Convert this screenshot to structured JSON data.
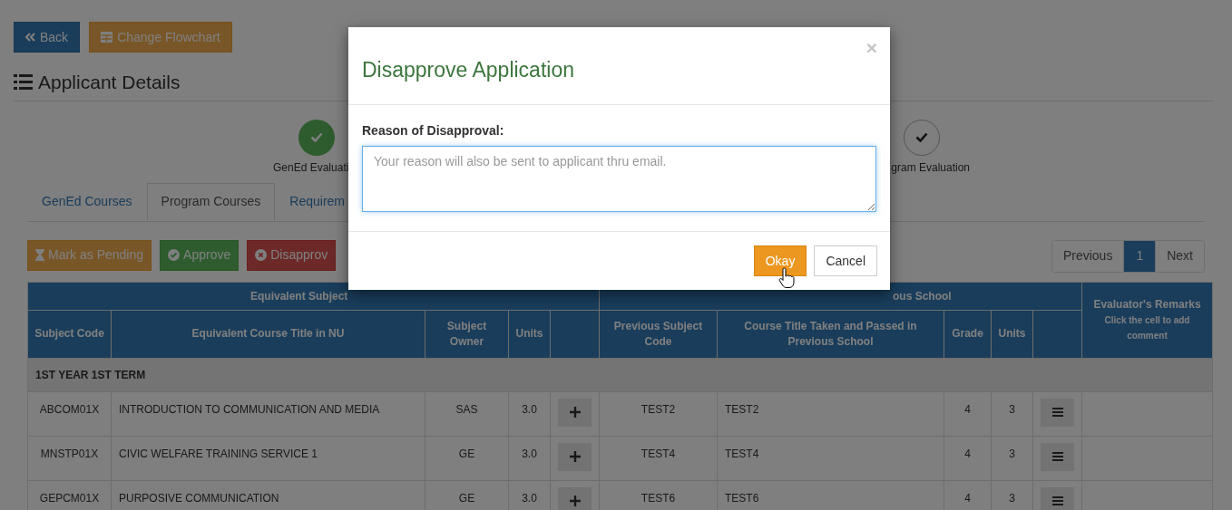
{
  "toolbar": [
    {
      "label": "Back",
      "kind": "back"
    },
    {
      "label": "Change Flowchart",
      "kind": "flowchart"
    }
  ],
  "heading": "Applicant Details",
  "stepper": [
    {
      "label": "GenEd Evaluati",
      "kind": "filled"
    },
    {
      "label": "gram Evaluation",
      "kind": "outline"
    }
  ],
  "tabs": [
    {
      "label": "GenEd Courses",
      "selected": false
    },
    {
      "label": "Program Courses",
      "selected": true
    },
    {
      "label": "Requirem",
      "selected": false
    }
  ],
  "actions": [
    {
      "label": "Mark as Pending",
      "kind": "pending"
    },
    {
      "label": "Approve",
      "kind": "approve"
    },
    {
      "label": "Disapprov",
      "kind": "disapprove"
    }
  ],
  "pagination": [
    {
      "label": "Previous",
      "selected": false
    },
    {
      "label": "1",
      "selected": true
    },
    {
      "label": "Next",
      "selected": false
    }
  ],
  "table": {
    "groups": [
      "Equivalent Subject",
      "ous School"
    ],
    "columns": [
      "Subject Code",
      "Equivalent Course Title in NU",
      "Subject Owner",
      "Units",
      "Previous Subject Code",
      "Course Title Taken and Passed in Previous School",
      "Grade",
      "Units"
    ],
    "remarks": {
      "title": "Evaluator's Remarks",
      "hint": "Click the cell to add comment"
    },
    "sections": [
      {
        "title": "1ST YEAR 1ST TERM",
        "rows": [
          {
            "code": "ABCOM01X",
            "title": "INTRODUCTION TO COMMUNICATION AND MEDIA",
            "owner": "SAS",
            "units": "3.0",
            "prev_code": "TEST2",
            "prev_title": "TEST2",
            "grade": "4",
            "prev_units": "3"
          },
          {
            "code": "MNSTP01X",
            "title": "CIVIC WELFARE TRAINING SERVICE 1",
            "owner": "GE",
            "units": "3.0",
            "prev_code": "TEST4",
            "prev_title": "TEST4",
            "grade": "4",
            "prev_units": "3"
          },
          {
            "code": "GEPCM01X",
            "title": "PURPOSIVE COMMUNICATION",
            "owner": "GE",
            "units": "3.0",
            "prev_code": "TEST6",
            "prev_title": "TEST6",
            "grade": "4",
            "prev_units": "3"
          }
        ]
      }
    ]
  },
  "modal": {
    "title": "Disapprove Application",
    "close": "×",
    "label": "Reason of Disapproval:",
    "placeholder": "Your reason will also be sent to applicant thru email.",
    "buttons": [
      {
        "label": "Okay",
        "kind": "primary"
      },
      {
        "label": "Cancel",
        "kind": "default"
      }
    ]
  }
}
